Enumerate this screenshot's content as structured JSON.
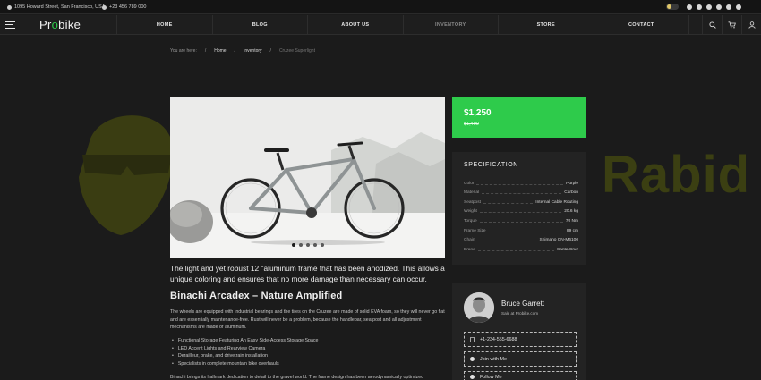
{
  "topbar": {
    "address": "1095 Howard Street, San Francisco, USA",
    "phone": "+23 456 789 000",
    "socials": [
      "facebook-icon",
      "twitter-icon",
      "vimeo-icon",
      "github-icon",
      "pinterest-icon",
      "linkedin-icon"
    ]
  },
  "nav": {
    "logo_pre": "Pr",
    "logo_accent": "o",
    "logo_post": "bike",
    "items": [
      "HOME",
      "BLOG",
      "ABOUT US",
      "INVENTORY",
      "STORE",
      "CONTACT"
    ]
  },
  "breadcrumb": {
    "prefix": "You are here:",
    "home": "Home",
    "section": "Inventory",
    "current": "Cruzee Superlight"
  },
  "watermark": "Rabid",
  "gallery": {
    "slides": 5,
    "active": 0
  },
  "product": {
    "lead": "The light and yet robust 12 \"aluminum frame that has been anodized. This allows a unique coloring and ensures that no more damage than necessary can occur.",
    "title": "Binachi Arcadex – Nature Amplified",
    "description": "The wheels are equipped with Industrial bearings and the tires on the Cruzee are made of solid EVA foam, so they will never go flat and are essentially maintenance-free. Rust will never be a problem, because the handlebar, seatpost and all adjustment mechanisms are made of aluminum.",
    "features": [
      "Functional Storage Featuring An Easy Side-Access Storage Space",
      "LED Accent Lights and Rearview Camera",
      "Derailleur, brake, and drivetrain installation",
      "Specialists in complete mountain bike overhauls"
    ],
    "more": "Binachi brings its hallmark dedication to detail to the gravel world. The frame design has been aerodynamically optimized"
  },
  "price": {
    "current": "$1,250",
    "old": "$1,490"
  },
  "spec": {
    "heading": "SPECIFICATION",
    "rows": [
      {
        "k": "Color",
        "v": "Purple"
      },
      {
        "k": "Material",
        "v": "Carbon"
      },
      {
        "k": "Seatpost",
        "v": "Internal Cable Routing"
      },
      {
        "k": "Weight",
        "v": "20.6 kg"
      },
      {
        "k": "Torque",
        "v": "70 Nm"
      },
      {
        "k": "Frame Size",
        "v": "89 cm"
      },
      {
        "k": "Chain",
        "v": "Shimano CN-M6100"
      },
      {
        "k": "Brand",
        "v": "Santa Cruz"
      }
    ]
  },
  "author": {
    "name": "Bruce Garrett",
    "role": "Sale at Probike.com",
    "phone": "+1-234-555-6688",
    "join": "Join with Me",
    "follow": "Follow Me"
  },
  "colors": {
    "accent": "#2ecb4b",
    "background": "#1b1b1b",
    "card": "#232323"
  }
}
